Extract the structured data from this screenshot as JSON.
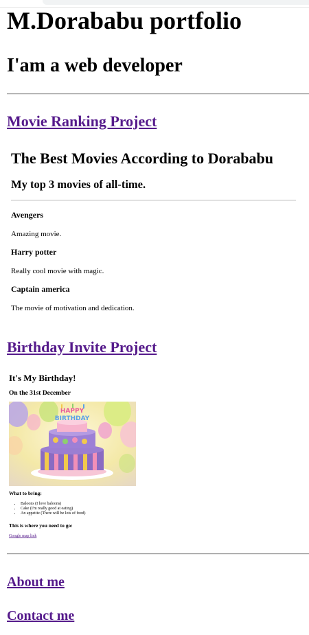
{
  "header": {
    "title": "M.Dorababu portfolio",
    "subtitle": "I'am a web developer"
  },
  "projects": {
    "movie_link": "Movie Ranking Project",
    "birthday_link": "Birthday Invite Project"
  },
  "movie_page": {
    "title": "The Best Movies According to Dorababu",
    "subtitle": "My top 3 movies of all-time.",
    "movies": [
      {
        "name": "Avengers",
        "description": "Amazing movie."
      },
      {
        "name": "Harry potter",
        "description": "Really cool movie with magic."
      },
      {
        "name": "Captain america",
        "description": "The movie of motivation and dedication."
      }
    ]
  },
  "birthday_page": {
    "title": "It's My Birthday!",
    "date": "On the 31st December",
    "cake_text": "HAPPY BIRTHDAY",
    "bring_heading": "What to bring:",
    "bring_items": [
      "Baloons (I love baloons)",
      "Cake (I'm really good at eating)",
      "An appetite (There will be lots of food)"
    ],
    "where_heading": "This is where you need to go:",
    "map_link": "Google map link"
  },
  "footer": {
    "about_link": "About me",
    "contact_link": "Contact me"
  },
  "colors": {
    "visited_link": "#551a8b",
    "rule": "#9b9b9b"
  }
}
